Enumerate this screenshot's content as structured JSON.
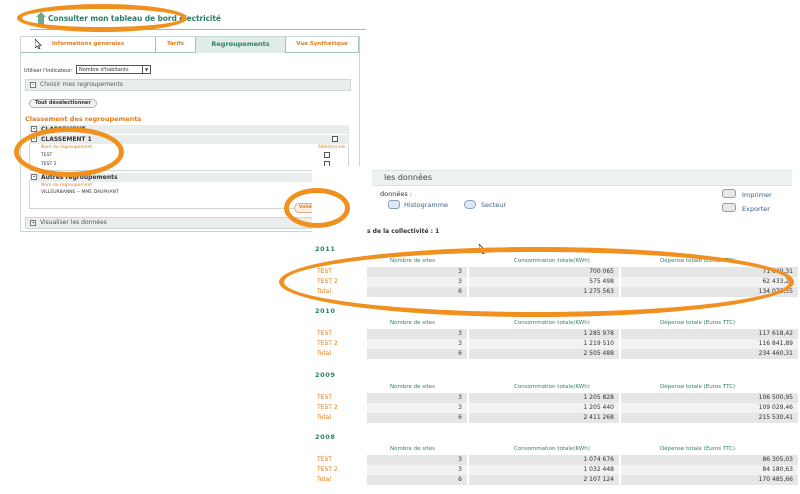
{
  "header": {
    "title": "Consulter mon tableau de bord électricité"
  },
  "left": {
    "tabs": [
      "Informations générales",
      "Tarifs",
      "Regroupements",
      "Vue Synthétique"
    ],
    "active_tab": 2,
    "indicator_label": "Utiliser l'indicateur:",
    "indicator_value": "Nombre d'habitants",
    "choose_label": "Choisir mes regroupements",
    "deselect_all": "Tout désélectionner",
    "classement_title": "Classement des regroupements",
    "group1_head": "CLASSEMENT",
    "classement1": "CLASSEMENT 1",
    "nom_regroupement": "Nom du regroupement",
    "selectionner": "Sélectionner",
    "items1": [
      "TEST",
      "TEST 2"
    ],
    "autres_head": "Autres regroupements",
    "items2": [
      "VILLEURBANNE -- MME DAUPHANT"
    ],
    "valider": "Valider la sélection",
    "visualiser": "Visualiser les données"
  },
  "right": {
    "bar_title": "les données",
    "donnees_label": "données :",
    "histogramme": "Histogramme",
    "secteur": "Secteur",
    "imprimer": "Imprimer",
    "exporter": "Exporter",
    "collect_title": "s de la collectivité : 1",
    "col_sites": "Nombre de sites",
    "col_conso": "Consommation totale(KWh)",
    "col_depense": "Dépense totale (Euros TTC)",
    "years": [
      {
        "year": "2011",
        "rows": [
          {
            "label": "TEST",
            "sites": "3",
            "conso": "700 065",
            "depense": "71 640,31"
          },
          {
            "label": "TEST 2",
            "sites": "3",
            "conso": "575 498",
            "depense": "62 433,24"
          },
          {
            "label": "Total",
            "sites": "6",
            "conso": "1 275 563",
            "depense": "134 073,55"
          }
        ]
      },
      {
        "year": "2010",
        "rows": [
          {
            "label": "TEST",
            "sites": "3",
            "conso": "1 285 978",
            "depense": "117 618,42"
          },
          {
            "label": "TEST 2",
            "sites": "3",
            "conso": "1 219 510",
            "depense": "116 841,89"
          },
          {
            "label": "Total",
            "sites": "6",
            "conso": "2 505 488",
            "depense": "234 460,31"
          }
        ]
      },
      {
        "year": "2009",
        "rows": [
          {
            "label": "TEST",
            "sites": "3",
            "conso": "1 205 828",
            "depense": "106 500,95"
          },
          {
            "label": "TEST 2",
            "sites": "3",
            "conso": "1 205 440",
            "depense": "109 029,46"
          },
          {
            "label": "Total",
            "sites": "6",
            "conso": "2 411 268",
            "depense": "215 530,41"
          }
        ]
      },
      {
        "year": "2008",
        "rows": [
          {
            "label": "TEST",
            "sites": "3",
            "conso": "1 074 676",
            "depense": "86 305,03"
          },
          {
            "label": "TEST 2",
            "sites": "3",
            "conso": "1 032 448",
            "depense": "84 180,63"
          },
          {
            "label": "Total",
            "sites": "6",
            "conso": "2 107 124",
            "depense": "170 485,66"
          }
        ]
      }
    ]
  },
  "colors": {
    "accent_orange": "#e07b17",
    "accent_green": "#2f7e6a",
    "annotation": "#f0901e"
  }
}
